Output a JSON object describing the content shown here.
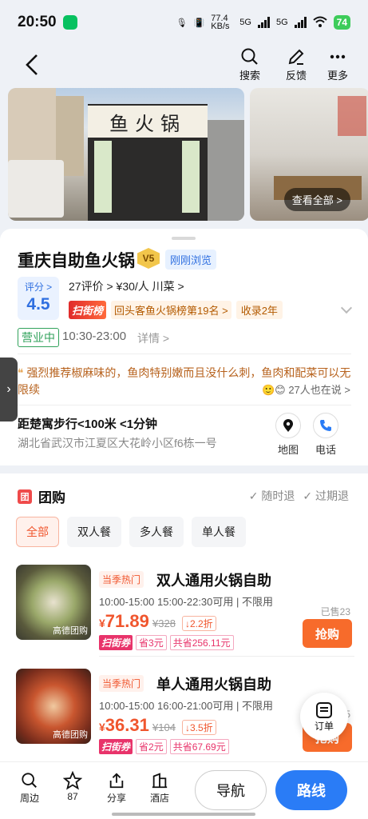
{
  "status_bar": {
    "time": "20:50",
    "net_speed": "77.4 KB/s",
    "sig1": "5G",
    "sig2": "5G",
    "battery": "74"
  },
  "topnav": {
    "search": "搜索",
    "feedback": "反馈",
    "more": "更多"
  },
  "photos": {
    "sign_text": "鱼火锅",
    "view_all": "查看全部 >"
  },
  "shop": {
    "name": "重庆自助鱼火锅",
    "level": "V5",
    "recent": "刚刚浏览",
    "score_label": "评分 >",
    "score": "4.5",
    "meta": "27评价 > ¥30/人  川菜 >",
    "rank_tag": "扫街榜",
    "rank_text": "回头客鱼火锅榜第19名 >",
    "collect": "收录2年",
    "status": "营业中",
    "hours": "10:30-23:00",
    "details": "详情 >",
    "review": "强烈推荐椒麻味的，鱼肉特别嫩而且没什么刺，鱼肉和配菜可以无限续",
    "also_say": "27人也在说 >",
    "distance": "距楚寓步行<100米 <1分钟",
    "address": "湖北省武汉市江夏区大花岭小区f6栋一号",
    "map": "地图",
    "phone": "电话"
  },
  "groupon": {
    "title": "团购",
    "icon": "团",
    "refund1": "随时退",
    "refund2": "过期退",
    "chips": [
      "全部",
      "双人餐",
      "多人餐",
      "单人餐"
    ],
    "deals": [
      {
        "hot": "当季热门",
        "name": "双人通用火锅自助",
        "usage": "10:00-15:00 15:00-22:30可用 | 不限用",
        "sold": "已售23",
        "price_symbol": "¥",
        "price": "71.89",
        "orig": "¥328",
        "disc": "↓2.2折",
        "coupon_tag": "扫街券",
        "save1": "省3元",
        "save2": "共省256.11元",
        "buy": "抢购",
        "pic_caption": "高德团购"
      },
      {
        "hot": "当季热门",
        "name": "单人通用火锅自助",
        "usage": "10:00-15:00 16:00-21:00可用 | 不限用",
        "sold": "5",
        "price_symbol": "¥",
        "price": "36.31",
        "orig": "¥104",
        "disc": "↓3.5折",
        "coupon_tag": "扫街券",
        "save1": "省2元",
        "save2": "共省67.69元",
        "buy": "抢购",
        "pic_caption": "高德团购"
      }
    ]
  },
  "order_fab": "订单",
  "bottom": {
    "nearby": "周边",
    "fav_count": "87",
    "share": "分享",
    "hotel": "酒店",
    "navigate": "导航",
    "route": "路线"
  }
}
